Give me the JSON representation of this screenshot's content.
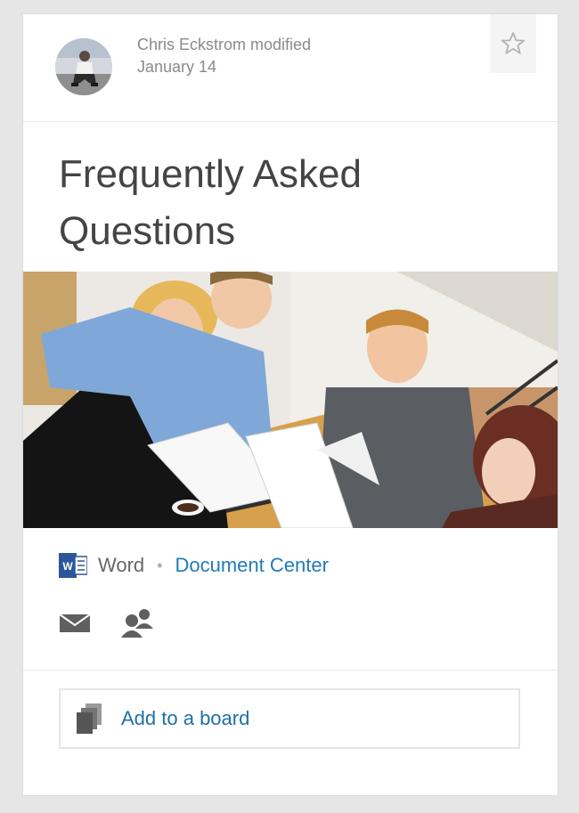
{
  "header": {
    "author": "Chris Eckstrom",
    "action": "modified",
    "date": "January 14",
    "star_icon": "star-outline-icon"
  },
  "title": "Frequently Asked Questions",
  "preview": {
    "subject": "four people smiling and reviewing documents around a table"
  },
  "source": {
    "app_icon": "word-icon",
    "app": "Word",
    "separator": "•",
    "location": "Document Center"
  },
  "actions": [
    {
      "icon": "mail-icon"
    },
    {
      "icon": "people-icon"
    }
  ],
  "board": {
    "icon": "boards-icon",
    "label": "Add to a board"
  },
  "colors": {
    "link": "#1f7cb6",
    "word_blue": "#2b579a",
    "text": "#444444",
    "meta": "#8a8a8a"
  }
}
